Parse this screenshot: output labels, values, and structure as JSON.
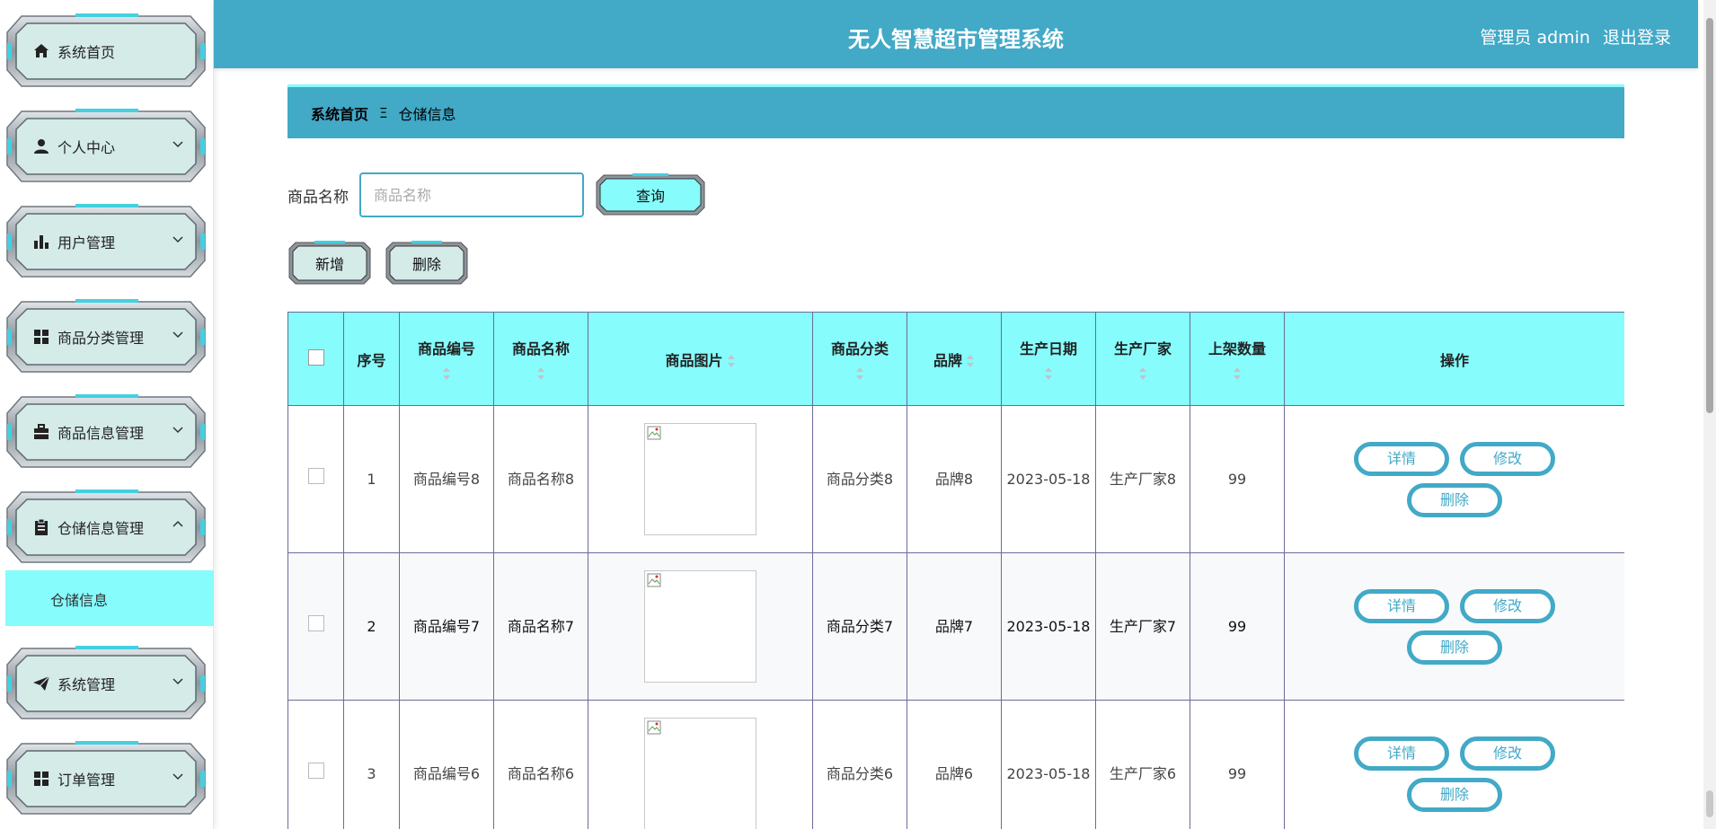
{
  "header": {
    "title": "无人智慧超市管理系统",
    "user_label": "管理员 admin",
    "logout_label": "退出登录"
  },
  "sidebar": {
    "items": [
      {
        "label": "系统首页",
        "icon": "home-icon",
        "expanded": null
      },
      {
        "label": "个人中心",
        "icon": "user-icon",
        "expanded": false
      },
      {
        "label": "用户管理",
        "icon": "bar-chart-icon",
        "expanded": false
      },
      {
        "label": "商品分类管理",
        "icon": "grid-icon",
        "expanded": false
      },
      {
        "label": "商品信息管理",
        "icon": "briefcase-icon",
        "expanded": false
      },
      {
        "label": "仓储信息管理",
        "icon": "clipboard-icon",
        "expanded": true
      },
      {
        "label": "系统管理",
        "icon": "paper-plane-icon",
        "expanded": false
      },
      {
        "label": "订单管理",
        "icon": "grid-icon",
        "expanded": false
      }
    ],
    "submenu": {
      "label": "仓储信息"
    }
  },
  "breadcrumb": {
    "home": "系统首页",
    "separator": "Ξ",
    "current": "仓储信息"
  },
  "search": {
    "label": "商品名称",
    "placeholder": "商品名称",
    "query_label": "查询"
  },
  "actions": {
    "add_label": "新增",
    "delete_label": "删除"
  },
  "table": {
    "headers": {
      "index": "序号",
      "code": "商品编号",
      "name": "商品名称",
      "image": "商品图片",
      "category": "商品分类",
      "brand": "品牌",
      "date": "生产日期",
      "maker": "生产厂家",
      "qty": "上架数量",
      "ops": "操作"
    },
    "op_labels": {
      "detail": "详情",
      "edit": "修改",
      "delete": "删除"
    },
    "rows": [
      {
        "index": "1",
        "code": "商品编号8",
        "name": "商品名称8",
        "category": "商品分类8",
        "brand": "品牌8",
        "date": "2023-05-18",
        "maker": "生产厂家8",
        "qty": "99"
      },
      {
        "index": "2",
        "code": "商品编号7",
        "name": "商品名称7",
        "category": "商品分类7",
        "brand": "品牌7",
        "date": "2023-05-18",
        "maker": "生产厂家7",
        "qty": "99"
      },
      {
        "index": "3",
        "code": "商品编号6",
        "name": "商品名称6",
        "category": "商品分类6",
        "brand": "品牌6",
        "date": "2023-05-18",
        "maker": "生产厂家6",
        "qty": "99"
      }
    ]
  },
  "colors": {
    "primary": "#42a9c7",
    "accent": "#86fcfc",
    "menu_bg": "#d4ebe8"
  }
}
